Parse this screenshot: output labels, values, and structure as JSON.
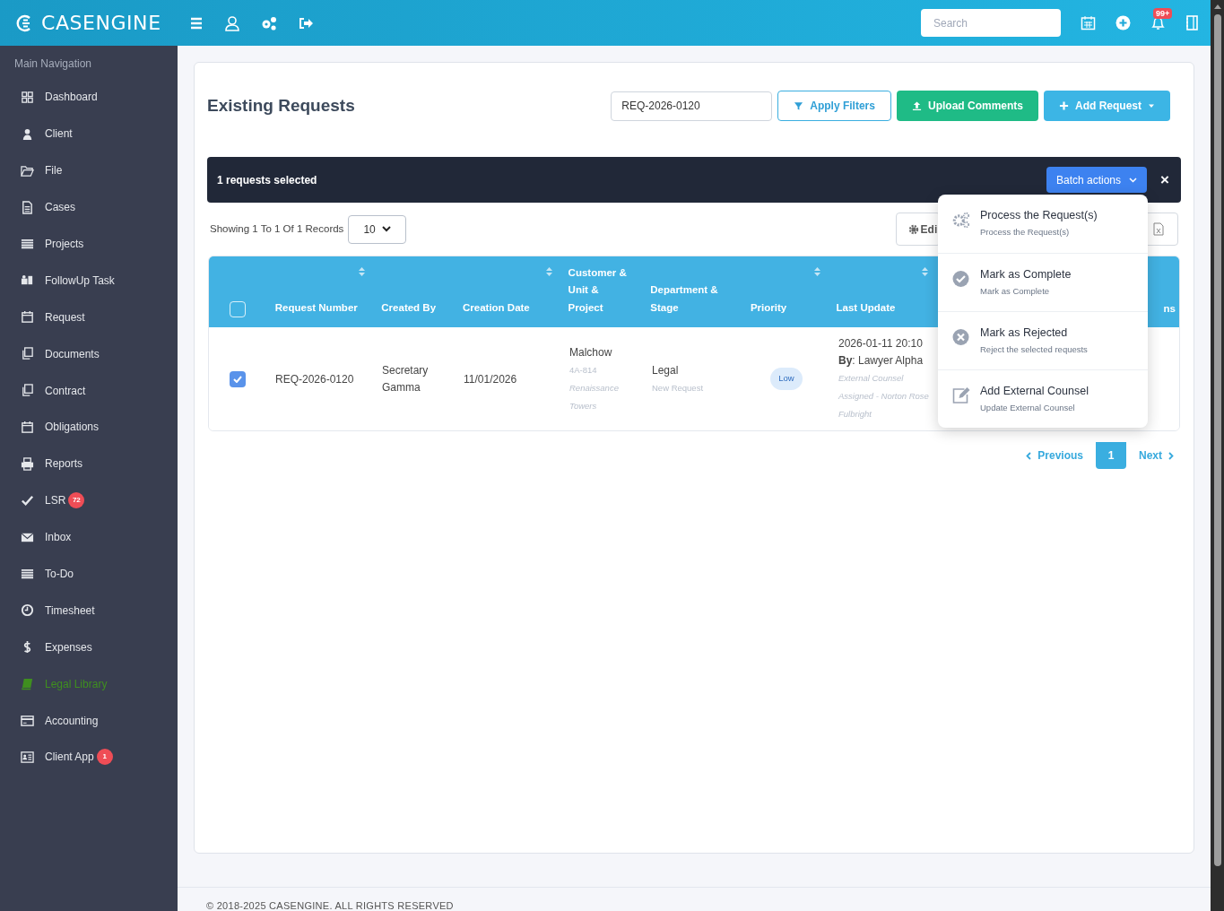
{
  "topbar": {
    "logo": "CASENGINE",
    "search": {
      "placeholder": "Search"
    },
    "notification_badge": "99+"
  },
  "sidebar": {
    "heading": "Main Navigation",
    "items": [
      {
        "label": "Dashboard",
        "color": "#e5e7eb"
      },
      {
        "label": "Client",
        "color": "#e5e7eb"
      },
      {
        "label": "File",
        "color": "#e5e7eb"
      },
      {
        "label": "Cases",
        "color": "#e5e7eb"
      },
      {
        "label": "Projects",
        "color": "#e5e7eb"
      },
      {
        "label": "FollowUp Task",
        "color": "#e5e7eb"
      },
      {
        "label": "Request",
        "color": "#e5e7eb"
      },
      {
        "label": "Documents",
        "color": "#e5e7eb"
      },
      {
        "label": "Contract",
        "color": "#e5e7eb"
      },
      {
        "label": "Obligations",
        "color": "#e5e7eb"
      },
      {
        "label": "Reports",
        "color": "#e5e7eb"
      },
      {
        "label": "LSR",
        "color": "#e5e7eb",
        "badge": "72"
      },
      {
        "label": "Inbox",
        "color": "#e5e7eb"
      },
      {
        "label": "To-Do",
        "color": "#e5e7eb"
      },
      {
        "label": "Timesheet",
        "color": "#e5e7eb"
      },
      {
        "label": "Expenses",
        "color": "#e5e7eb"
      },
      {
        "label": "Legal Library",
        "color": "#3f8f1f"
      },
      {
        "label": "Accounting",
        "color": "#e5e7eb"
      },
      {
        "label": "Client App",
        "color": "#e5e7eb",
        "badge": "1"
      }
    ]
  },
  "page": {
    "title": "Existing Requests",
    "filter_value": "REQ-2026-0120",
    "buttons": [
      {
        "label": "Apply Filters",
        "kind": "filter"
      },
      {
        "label": "Upload Comments",
        "kind": "upload"
      },
      {
        "label": "Add Request",
        "kind": "add"
      }
    ]
  },
  "selection_bar": {
    "text": "1 requests selected",
    "batch_button": "Batch actions",
    "close": "×"
  },
  "records": {
    "showing": "Showing 1 To 1 Of 1 Records",
    "page_size": "10",
    "edit_button": "Edi"
  },
  "batch_menu": [
    {
      "title": "Process the Request(s)",
      "subtitle": "Process the Request(s)"
    },
    {
      "title": "Mark as Complete",
      "subtitle": "Mark as Complete"
    },
    {
      "title": "Mark as Rejected",
      "subtitle": "Reject the selected requests"
    },
    {
      "title": "Add External Counsel",
      "subtitle": "Update External Counsel"
    }
  ],
  "table": {
    "all_checked": false,
    "columns": [
      {
        "label": "Request Number",
        "sortable": true
      },
      {
        "label": "Created By",
        "sortable": false
      },
      {
        "label": "Creation Date",
        "sortable": true
      },
      {
        "label": "Customer & Unit & Project",
        "sortable": false
      },
      {
        "label": "Department & Stage",
        "sortable": false
      },
      {
        "label": "Priority",
        "sortable": true
      },
      {
        "label": "Last Update",
        "sortable": true
      }
    ],
    "column_8": "ns",
    "rows": [
      {
        "checked": true,
        "request_number": "REQ-2026-0120",
        "created_by": "Secretary Gamma",
        "creation_date": "11/01/2026",
        "customer": "Malchow",
        "unit": "4A-814",
        "project": "Renaissance Towers",
        "department": "Legal",
        "stage": "New Request",
        "priority": "Low",
        "last_update": "2026-01-11 20:10",
        "by_label": "By",
        "by_name": ": Lawyer Alpha",
        "note": "External Counsel Assigned - Norton Rose Fulbright"
      }
    ]
  },
  "pagination": {
    "previous": "Previous",
    "current": "1",
    "next": "Next"
  },
  "footer": {
    "copyright": "© 2018-2025 CASENGINE. ALL RIGHTS RESERVED"
  }
}
